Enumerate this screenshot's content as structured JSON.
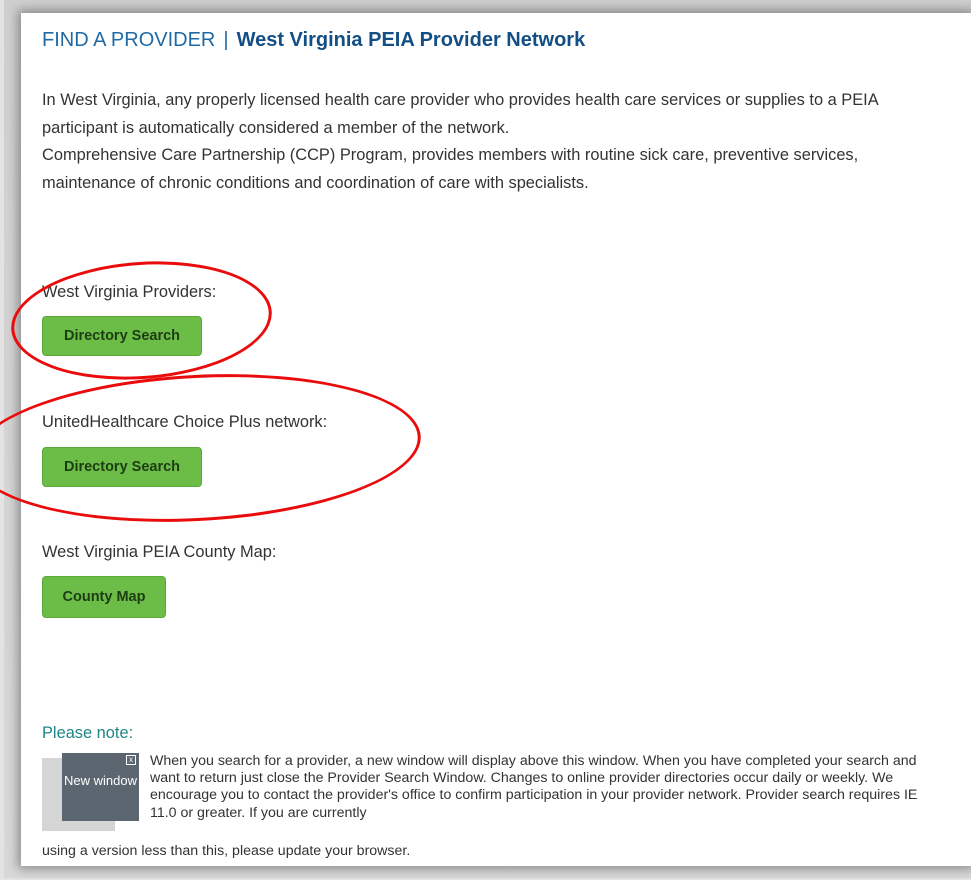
{
  "header": {
    "section": "FIND A PROVIDER",
    "separator": "|",
    "network": "West Virginia PEIA Provider Network"
  },
  "intro": {
    "line1": "In West Virginia, any properly licensed health care provider who provides health care services or supplies to a PEIA participant is automatically considered a member of the network.",
    "line2": "Comprehensive Care Partnership (CCP) Program, provides members with routine sick care, preventive services, maintenance of chronic conditions and coordination of care with specialists."
  },
  "sections": [
    {
      "label": "West Virginia Providers:",
      "button": "Directory Search"
    },
    {
      "label": "UnitedHealthcare Choice Plus network:",
      "button": "Directory Search"
    },
    {
      "label": "West Virginia PEIA County Map:",
      "button": "County Map"
    }
  ],
  "annotations": {
    "color": "#ea0c0c"
  },
  "note": {
    "title": "Please note:",
    "thumbnail_text": "New window",
    "thumbnail_close": "x",
    "body": "When you search for a provider, a new window will display above this window. When you have completed your search and want to return just close the Provider Search Window. Changes to online provider directories occur daily or weekly. We encourage you to contact the provider's office to confirm participation in your provider network. Provider search requires IE 11.0 or greater. If you are currently",
    "tail": "using a version less than this, please update your browser."
  },
  "colors": {
    "button_green": "#6cbc48",
    "header_blue": "#1f6aa5",
    "note_teal": "#1f8585"
  }
}
